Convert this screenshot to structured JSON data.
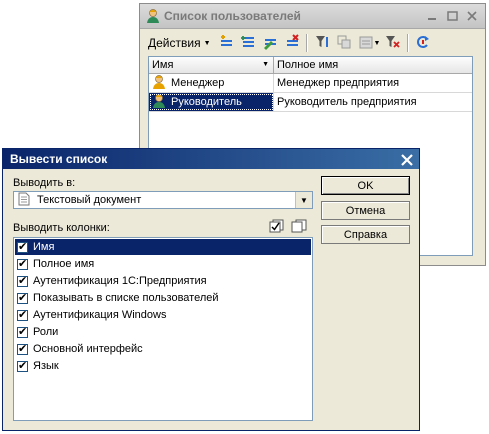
{
  "users_window": {
    "title": "Список пользователей",
    "actions_label": "Действия",
    "columns": {
      "name": "Имя",
      "full_name": "Полное имя"
    },
    "rows": [
      {
        "name": "Менеджер",
        "full_name": "Менеджер предприятия",
        "selected": false
      },
      {
        "name": "Руководитель",
        "full_name": "Руководитель предприятия",
        "selected": true
      }
    ]
  },
  "dialog": {
    "title": "Вывести список",
    "output_label": "Выводить в:",
    "output_value": "Текстовый документ",
    "columns_label": "Выводить колонки:",
    "columns": [
      {
        "label": "Имя",
        "checked": true,
        "selected": true
      },
      {
        "label": "Полное имя",
        "checked": true
      },
      {
        "label": "Аутентификация 1С:Предприятия",
        "checked": true
      },
      {
        "label": "Показывать в списке пользователей",
        "checked": true
      },
      {
        "label": "Аутентификация Windows",
        "checked": true
      },
      {
        "label": "Роли",
        "checked": true
      },
      {
        "label": "Основной интерфейс",
        "checked": true
      },
      {
        "label": "Язык",
        "checked": true
      }
    ],
    "buttons": {
      "ok": "OK",
      "cancel": "Отмена",
      "help": "Справка"
    }
  },
  "icons": {
    "user": "user-icon",
    "add": "add-icon",
    "copy": "copy-icon",
    "edit": "edit-icon",
    "delete": "delete-icon",
    "filter": "filter-icon",
    "hierarchy": "hierarchy-icon",
    "list_mode": "list-mode-icon",
    "clear_filter": "clear-filter-icon",
    "refresh": "refresh-icon",
    "check_all": "check-all-icon",
    "uncheck_all": "uncheck-all-icon",
    "document": "text-document-icon"
  },
  "colors": {
    "selection": "#0a246a",
    "dialog_title": "#0a246a",
    "face": "#ece9d8"
  }
}
